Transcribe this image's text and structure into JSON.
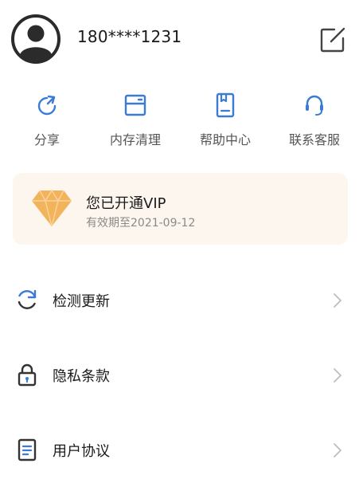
{
  "profile": {
    "phone": "180****1231",
    "avatar_icon": "user-avatar-icon",
    "edit_icon": "edit-icon"
  },
  "quick_actions": [
    {
      "label": "分享",
      "icon": "share-icon"
    },
    {
      "label": "内存清理",
      "icon": "memory-clean-icon"
    },
    {
      "label": "帮助中心",
      "icon": "help-center-icon"
    },
    {
      "label": "联系客服",
      "icon": "customer-service-icon"
    }
  ],
  "vip": {
    "title": "您已开通VIP",
    "expire": "有效期至2021-09-12",
    "icon": "diamond-icon"
  },
  "menu": [
    {
      "label": "检测更新",
      "icon": "refresh-icon"
    },
    {
      "label": "隐私条款",
      "icon": "lock-icon"
    },
    {
      "label": "用户协议",
      "icon": "document-icon"
    }
  ],
  "colors": {
    "accent": "#3a7bd5",
    "vip_bg": "#fcf6ee",
    "diamond": "#f2b35a",
    "text": "#1a1a1a",
    "muted": "#8a8a8a"
  }
}
